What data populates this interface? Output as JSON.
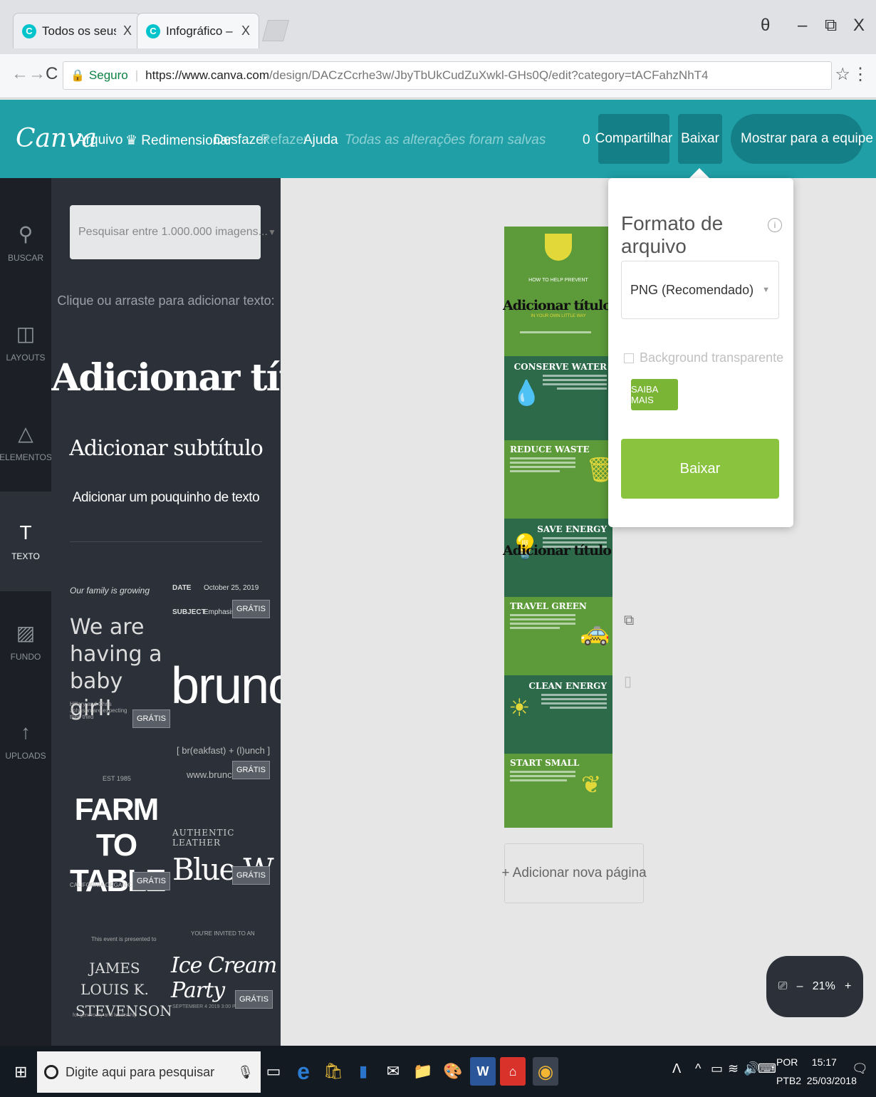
{
  "browser": {
    "tabs": [
      {
        "title": "Todos os seus designs -",
        "close": "X"
      },
      {
        "title": "Infográfico – o",
        "close": "X"
      }
    ],
    "window_controls": {
      "profile": "θ",
      "minimize": "–",
      "restore": "⧉",
      "close": "X"
    },
    "address": {
      "secure_label": "Seguro",
      "url_domain": "https://www.canva.com",
      "url_path": "/design/DACzCcrhe3w/JbyTbUkCudZuXwkl-GHs0Q/edit?category=tACFahzNhT4"
    }
  },
  "canva": {
    "logo": "Canva",
    "menu": {
      "file": "Arquivo",
      "resize": "♛ Redimensionar",
      "undo": "Desfazer",
      "redo": "Refazer",
      "help": "Ajuda"
    },
    "saved_status": "Todas as alterações foram salvas",
    "count": "0",
    "share": "Compartilhar",
    "download": "Baixar",
    "show_team": "Mostrar para a equipe"
  },
  "rail": [
    {
      "icon": "search-icon",
      "label": "BUSCAR"
    },
    {
      "icon": "layouts-icon",
      "label": "LAYOUTS"
    },
    {
      "icon": "elements-icon",
      "label": "ELEMENTOS"
    },
    {
      "icon": "text-icon",
      "label": "TEXTO"
    },
    {
      "icon": "background-icon",
      "label": "FUNDO"
    },
    {
      "icon": "upload-icon",
      "label": "UPLOADS"
    }
  ],
  "panel": {
    "search_placeholder": "Pesquisar entre 1.000.000 imagens...",
    "hint": "Clique ou arraste para adicionar texto:",
    "add_title": "Adicionar título",
    "add_subtitle": "Adicionar subtítulo",
    "add_body": "Adicionar um pouquinho de texto",
    "templates": {
      "family": "Our family is growing",
      "date_label": "DATE",
      "date_value": "October 25, 2019",
      "subject_label": "SUBJECT",
      "subject_value": "Emphasis (?)",
      "baby": "We are having a baby girl!",
      "baby_sub": "Hillary and Chris Johnson are expecting their third",
      "brunch": "brunch",
      "brunch_sub": "[ br(eakfast) + (l)unch ]",
      "brunch_url": "www.brunch.",
      "farm_est": "EST 1985",
      "farm": "FARM TO TABLE",
      "farm_sub": "CALIFORNIA ORGANIC",
      "leather": "AUTHENTIC LEATHER",
      "blue": "Blue W",
      "james_pre": "This event is presented to",
      "james": "JAMES LOUIS K. STEVENSON",
      "james_sub": "for generosity and leadership",
      "ice_pre": "YOU'RE INVITED TO AN",
      "ice": "Ice Cream Party",
      "ice_sub": "SEPTEMBER 4 2019 3:00 PM",
      "gratis": "GRÁTIS"
    }
  },
  "infographic": {
    "header_small": "HOW TO HELP PREVENT",
    "header_sub": "IN YOUR OWN LITTLE WAY",
    "overlay_title": "Adicionar título",
    "sections": [
      {
        "title": "CONSERVE WATER",
        "icon": "water-drop-icon"
      },
      {
        "title": "REDUCE WASTE",
        "icon": "trash-can-icon"
      },
      {
        "title": "SAVE ENERGY",
        "icon": "bulb-icon"
      },
      {
        "title": "TRAVEL GREEN",
        "icon": "car-icon"
      },
      {
        "title": "CLEAN ENERGY",
        "icon": "sun-icon"
      },
      {
        "title": "START SMALL",
        "icon": "plant-icon"
      }
    ],
    "colors": {
      "green": "#5c9a3a",
      "dark": "#2c6a4a",
      "accent": "#e3d83a"
    }
  },
  "add_page": "+ Adicionar nova página",
  "zoom": {
    "minus": "–",
    "level": "21%",
    "plus": "+"
  },
  "download_popover": {
    "title": "Formato de arquivo",
    "info": "i",
    "format": "PNG (Recomendado)",
    "transparent": "Background transparente",
    "learn_more": "SAIBA MAIS",
    "button": "Baixar"
  },
  "taskbar": {
    "search_placeholder": "Digite aqui para pesquisar",
    "lang": "POR",
    "lang2": "PTB2",
    "time": "15:17",
    "date": "25/03/2018"
  }
}
